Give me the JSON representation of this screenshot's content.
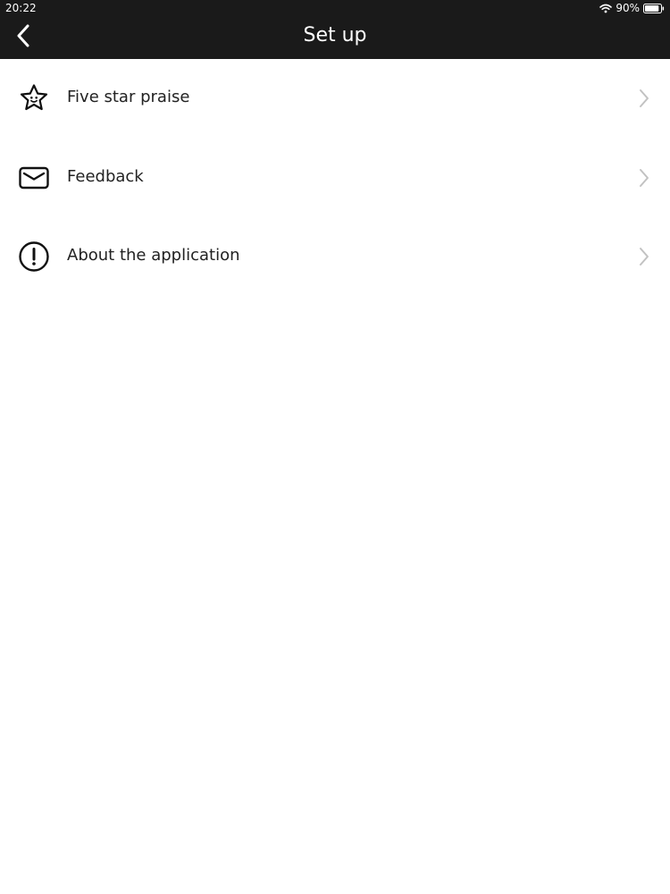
{
  "status_bar": {
    "time": "20:22",
    "battery_percent_label": "90%",
    "battery_level": 0.9,
    "wifi_icon": "wifi-icon",
    "battery_icon": "battery-icon"
  },
  "nav": {
    "title": "Set up",
    "back_icon": "chevron-left-icon"
  },
  "menu": {
    "items": [
      {
        "label": "Five star praise",
        "icon": "star-icon"
      },
      {
        "label": "Feedback",
        "icon": "envelope-icon"
      },
      {
        "label": "About the application",
        "icon": "info-alert-icon"
      }
    ]
  },
  "colors": {
    "bar_background": "#1a1a1a",
    "bar_text": "#ffffff",
    "page_background": "#ffffff",
    "label_text": "#222222",
    "icon_stroke": "#111111",
    "chevron": "#c2c2c2"
  }
}
